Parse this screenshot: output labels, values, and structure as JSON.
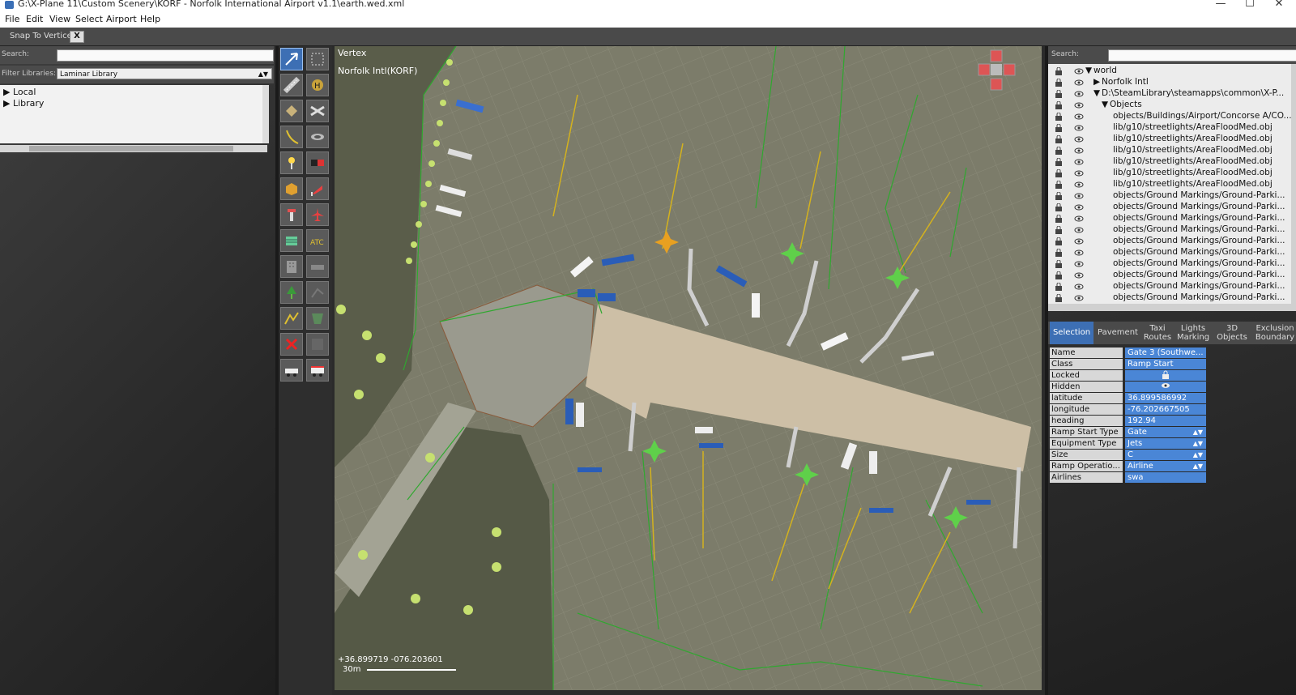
{
  "window": {
    "title": "G:\\X-Plane 11\\Custom Scenery\\KORF - Norfolk International Airport v1.1\\earth.wed.xml",
    "minimize": "—",
    "maximize": "☐",
    "close": "✕"
  },
  "menu": [
    "File",
    "Edit",
    "View",
    "Select",
    "Airport",
    "Help"
  ],
  "snap": {
    "label": "Snap To Vertices",
    "toggle": "X"
  },
  "left_panel": {
    "search_label": "Search:",
    "search_value": "",
    "filter_label": "Filter Libraries:",
    "filter_value": "Laminar Library",
    "tree": [
      "Local",
      "Library"
    ]
  },
  "map": {
    "tool_name": "Vertex",
    "airport": "Norfolk Intl(KORF)",
    "coords": "+36.899719 -076.203601",
    "scale": "30m"
  },
  "right_panel": {
    "search_label": "Search:",
    "hierarchy": [
      {
        "label": "world",
        "expander": "▼"
      },
      {
        "label": "Norfolk Intl",
        "expander": "▶"
      },
      {
        "label": "D:\\SteamLibrary\\steamapps\\common\\X-P...",
        "expander": "▼"
      },
      {
        "label": "Objects",
        "expander": "▼"
      },
      {
        "label": "objects/Buildings/Airport/Concorse A/CO...",
        "expander": ""
      },
      {
        "label": "lib/g10/streetlights/AreaFloodMed.obj",
        "expander": ""
      },
      {
        "label": "lib/g10/streetlights/AreaFloodMed.obj",
        "expander": ""
      },
      {
        "label": "lib/g10/streetlights/AreaFloodMed.obj",
        "expander": ""
      },
      {
        "label": "lib/g10/streetlights/AreaFloodMed.obj",
        "expander": ""
      },
      {
        "label": "lib/g10/streetlights/AreaFloodMed.obj",
        "expander": ""
      },
      {
        "label": "lib/g10/streetlights/AreaFloodMed.obj",
        "expander": ""
      },
      {
        "label": "objects/Ground Markings/Ground-Parki...",
        "expander": ""
      },
      {
        "label": "objects/Ground Markings/Ground-Parki...",
        "expander": ""
      },
      {
        "label": "objects/Ground Markings/Ground-Parki...",
        "expander": ""
      },
      {
        "label": "objects/Ground Markings/Ground-Parki...",
        "expander": ""
      },
      {
        "label": "objects/Ground Markings/Ground-Parki...",
        "expander": ""
      },
      {
        "label": "objects/Ground Markings/Ground-Parki...",
        "expander": ""
      },
      {
        "label": "objects/Ground Markings/Ground-Parki...",
        "expander": ""
      },
      {
        "label": "objects/Ground Markings/Ground-Parki...",
        "expander": ""
      },
      {
        "label": "objects/Ground Markings/Ground-Parki...",
        "expander": ""
      },
      {
        "label": "objects/Ground Markings/Ground-Parki...",
        "expander": ""
      }
    ],
    "tabs": [
      "Selection",
      "Pavement",
      "Taxi Routes",
      "Lights Marking",
      "3D Objects",
      "Exclusion Boundary"
    ],
    "active_tab": "Selection",
    "properties": [
      {
        "key": "Name",
        "value": "Gate 3 (Southwe..."
      },
      {
        "key": "Class",
        "value": "Ramp Start"
      },
      {
        "key": "Locked",
        "value": "lock-icon"
      },
      {
        "key": "Hidden",
        "value": "eye-icon"
      },
      {
        "key": "latitude",
        "value": "36.899586992"
      },
      {
        "key": "longitude",
        "value": "-76.202667505"
      },
      {
        "key": "heading",
        "value": "192.94"
      },
      {
        "key": "Ramp Start Type",
        "value": "Gate"
      },
      {
        "key": "Equipment Type",
        "value": "Jets"
      },
      {
        "key": "Size",
        "value": "C"
      },
      {
        "key": "Ramp Operatio...",
        "value": "Airline"
      },
      {
        "key": "Airlines",
        "value": "swa"
      }
    ]
  },
  "colors": {
    "accent": "#3d6fb4",
    "property_value": "#4a86d6",
    "tarmac": "#7c7c6a",
    "grass": "#5a5d4a",
    "terminal": "#cdbfa6",
    "boundary": "#2fa82f",
    "taxi_line": "#d4b21e"
  }
}
